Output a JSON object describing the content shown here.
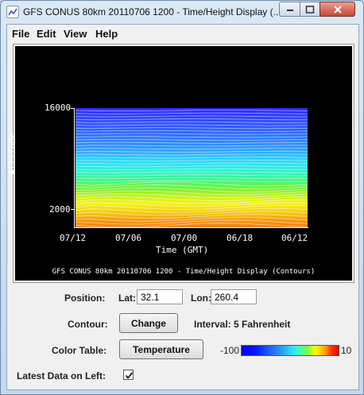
{
  "window": {
    "title": "GFS CONUS 80km 20110706 1200 - Time/Height Display (..."
  },
  "menu": [
    {
      "label": "File"
    },
    {
      "label": "Edit"
    },
    {
      "label": "View"
    },
    {
      "label": "Help"
    }
  ],
  "plot": {
    "y_label": "Altitude",
    "x_label": "Time (GMT)",
    "y_ticks": [
      "16000",
      "2000"
    ],
    "x_ticks": [
      "07/12",
      "07/06",
      "07/00",
      "06/18",
      "06/12"
    ],
    "caption": "GFS CONUS 80km 20110706 1200 - Time/Height Display (Contours)"
  },
  "position": {
    "label": "Position:",
    "lat_label": "Lat:",
    "lat_value": "32.1",
    "lon_label": "Lon:",
    "lon_value": "260.4"
  },
  "contour": {
    "label": "Contour:",
    "button": "Change",
    "interval": "Interval: 5 Fahrenheit"
  },
  "color_table": {
    "label": "Color Table:",
    "button": "Temperature",
    "min": "-100",
    "max": "10"
  },
  "latest": {
    "label": "Latest Data on Left:",
    "checked": true
  }
}
